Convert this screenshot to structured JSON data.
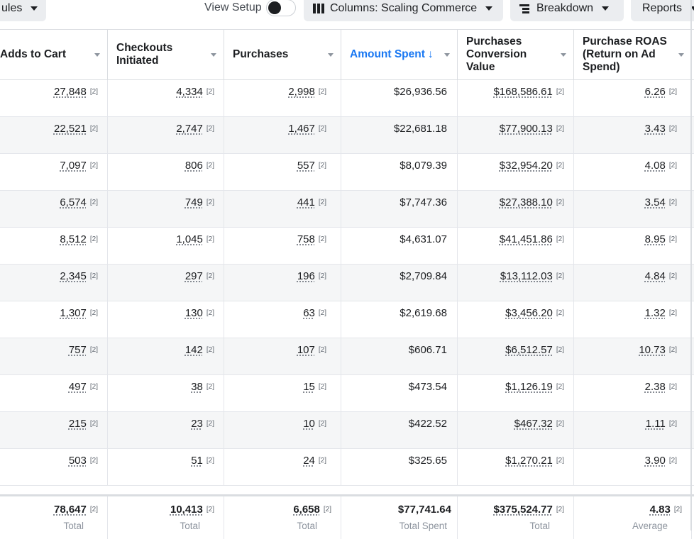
{
  "toolbar": {
    "rules_label": "ules",
    "view_setup_label": "View Setup",
    "columns_label": "Columns: Scaling Commerce",
    "breakdown_label": "Breakdown",
    "reports_label": "Reports"
  },
  "columns": [
    {
      "label": "Adds to Cart"
    },
    {
      "label": "Checkouts Initiated"
    },
    {
      "label": "Purchases"
    },
    {
      "label": "Amount Spent",
      "sorted": "desc"
    },
    {
      "label": "Purchases Conversion Value"
    },
    {
      "label": "Purchase ROAS (Return on Ad Spend)"
    }
  ],
  "sort_arrow": "↓",
  "footnote_marker": "[2]",
  "rows": [
    [
      "27,848",
      "4,334",
      "2,998",
      "$26,936.56",
      "$168,586.61",
      "6.26"
    ],
    [
      "22,521",
      "2,747",
      "1,467",
      "$22,681.18",
      "$77,900.13",
      "3.43"
    ],
    [
      "7,097",
      "806",
      "557",
      "$8,079.39",
      "$32,954.20",
      "4.08"
    ],
    [
      "6,574",
      "749",
      "441",
      "$7,747.36",
      "$27,388.10",
      "3.54"
    ],
    [
      "8,512",
      "1,045",
      "758",
      "$4,631.07",
      "$41,451.86",
      "8.95"
    ],
    [
      "2,345",
      "297",
      "196",
      "$2,709.84",
      "$13,112.03",
      "4.84"
    ],
    [
      "1,307",
      "130",
      "63",
      "$2,619.68",
      "$3,456.20",
      "1.32"
    ],
    [
      "757",
      "142",
      "107",
      "$606.71",
      "$6,512.57",
      "10.73"
    ],
    [
      "497",
      "38",
      "15",
      "$473.54",
      "$1,126.19",
      "2.38"
    ],
    [
      "215",
      "23",
      "10",
      "$422.52",
      "$467.32",
      "1.11"
    ],
    [
      "503",
      "51",
      "24",
      "$325.65",
      "$1,270.21",
      "3.90"
    ]
  ],
  "totals": [
    {
      "value": "78,647",
      "label": "Total"
    },
    {
      "value": "10,413",
      "label": "Total"
    },
    {
      "value": "6,658",
      "label": "Total"
    },
    {
      "value": "$77,741.64",
      "label": "Total Spent"
    },
    {
      "value": "$375,524.77",
      "label": "Total"
    },
    {
      "value": "4.83",
      "label": "Average"
    }
  ],
  "colors": {
    "accent": "#1877f2",
    "alt_row": "#f5f6f7",
    "muted_text": "#8d949e"
  }
}
